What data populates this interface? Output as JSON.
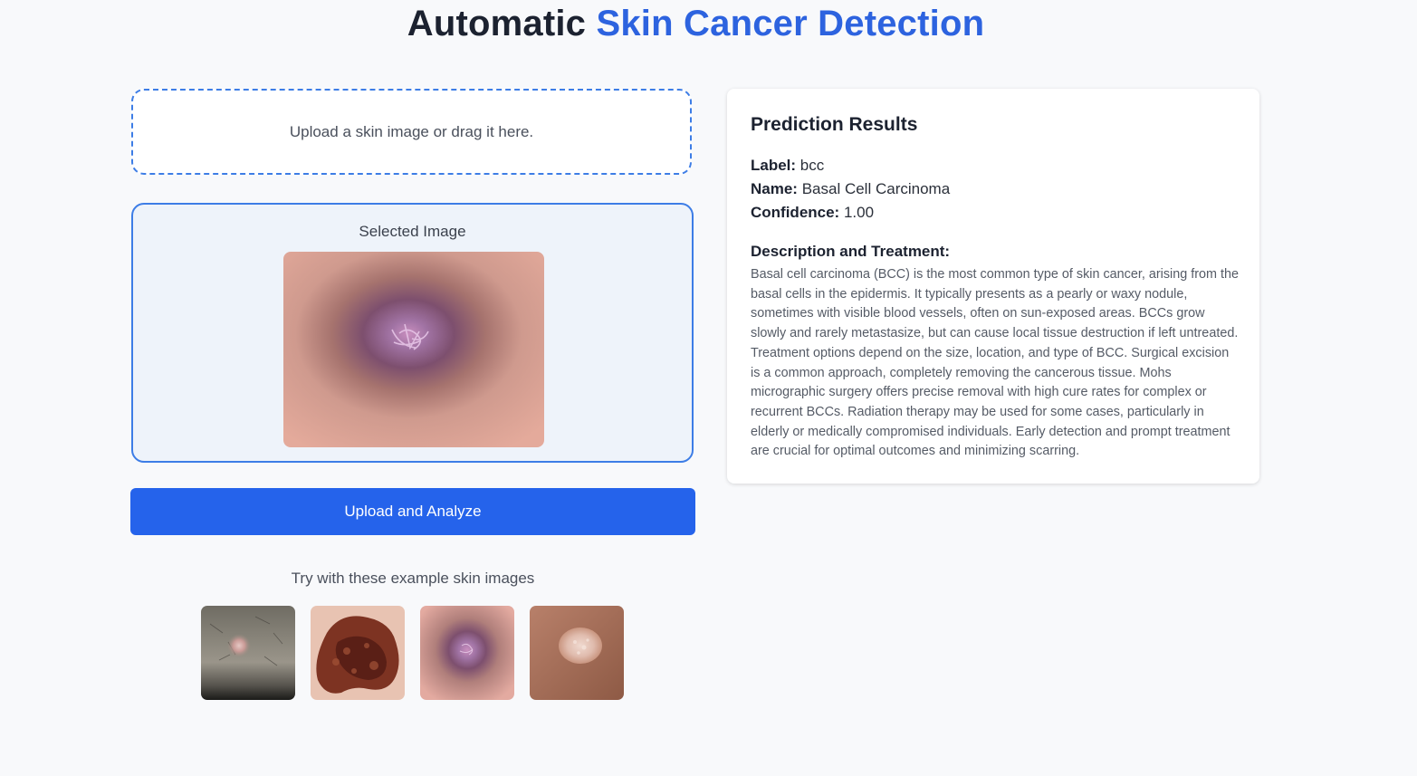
{
  "header": {
    "title_prefix": "Automatic",
    "title_accent": "Skin Cancer Detection"
  },
  "upload": {
    "dropzone_text": "Upload a skin image or drag it here.",
    "selected_label": "Selected Image",
    "analyze_button": "Upload and Analyze"
  },
  "examples": {
    "label": "Try with these example skin images",
    "items": [
      "example-image-1",
      "example-image-2",
      "example-image-3",
      "example-image-4"
    ]
  },
  "results": {
    "heading": "Prediction Results",
    "label_key": "Label:",
    "label_value": "bcc",
    "name_key": "Name:",
    "name_value": "Basal Cell Carcinoma",
    "confidence_key": "Confidence:",
    "confidence_value": "1.00",
    "description_heading": "Description and Treatment:",
    "description": "Basal cell carcinoma (BCC) is the most common type of skin cancer, arising from the basal cells in the epidermis. It typically presents as a pearly or waxy nodule, sometimes with visible blood vessels, often on sun-exposed areas. BCCs grow slowly and rarely metastasize, but can cause local tissue destruction if left untreated. Treatment options depend on the size, location, and type of BCC. Surgical excision is a common approach, completely removing the cancerous tissue. Mohs micrographic surgery offers precise removal with high cure rates for complex or recurrent BCCs. Radiation therapy may be used for some cases, particularly in elderly or medically compromised individuals. Early detection and prompt treatment are crucial for optimal outcomes and minimizing scarring."
  },
  "colors": {
    "accent": "#2d63df",
    "button": "#2563eb",
    "border": "#3d7de6",
    "background": "#f8f9fb"
  }
}
